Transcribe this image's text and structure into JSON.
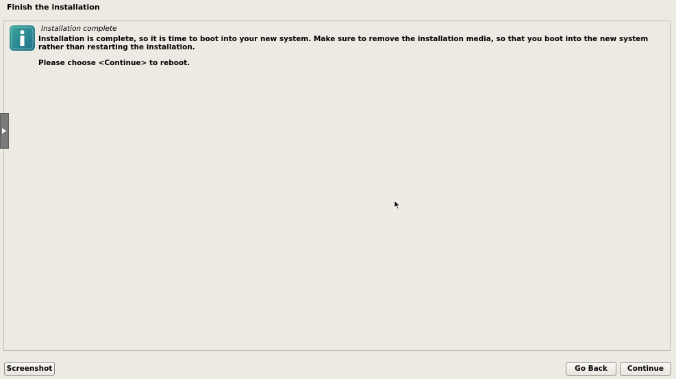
{
  "header": {
    "title": "Finish the installation"
  },
  "dialog": {
    "icon": "info-icon",
    "title": "Installation complete",
    "message": "Installation is complete, so it is time to boot into your new system. Make sure to remove the installation media, so that you boot into the new system rather than restarting the installation.",
    "prompt": "Please choose <Continue> to reboot."
  },
  "footer": {
    "screenshot_label": "Screenshot",
    "go_back_label": "Go Back",
    "continue_label": "Continue"
  },
  "colors": {
    "background": "#edeae3",
    "icon_gradient_start": "#3aa59b",
    "icon_gradient_end": "#1f6f8a"
  }
}
